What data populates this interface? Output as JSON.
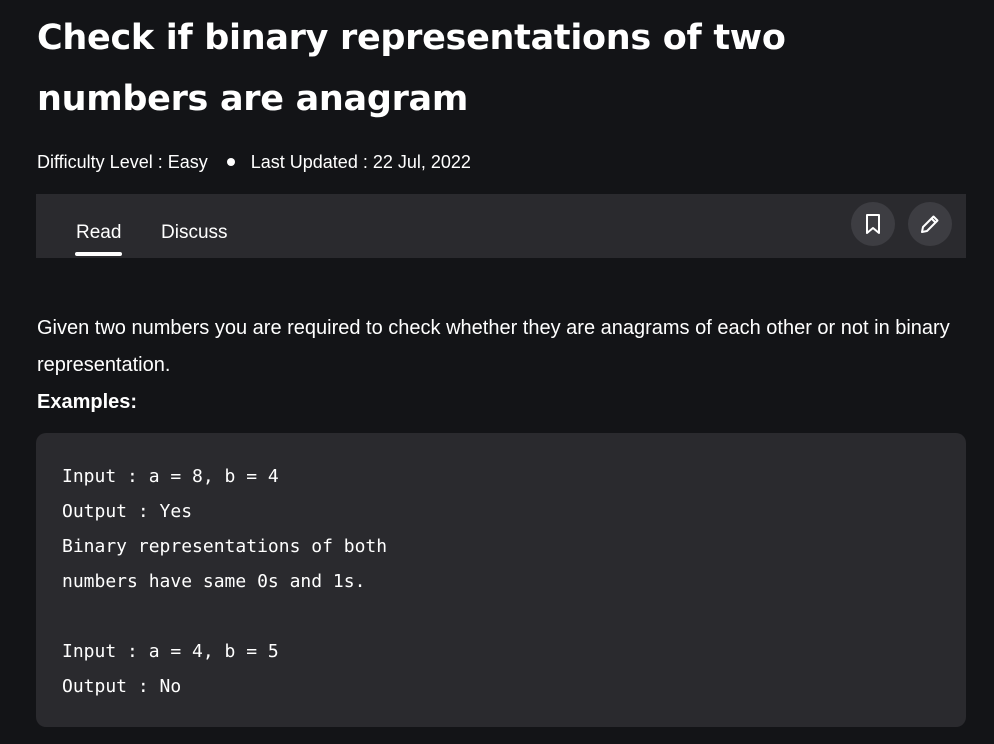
{
  "article": {
    "title": "Check if binary representations of two numbers are anagram",
    "difficulty": "Difficulty Level : Easy",
    "last_updated": "Last Updated : 22 Jul, 2022"
  },
  "tabs": [
    {
      "label": "Read",
      "active": true
    },
    {
      "label": "Discuss",
      "active": false
    }
  ],
  "actions": {
    "bookmark_icon": "bookmark-icon",
    "edit_icon": "pencil-icon"
  },
  "body": {
    "intro": "Given two numbers you are required to check whether they are anagrams of each other or not in binary representation.",
    "examples_heading": "Examples:",
    "code_lines": [
      "Input : a = 8, b = 4",
      "Output : Yes",
      "Binary representations of both",
      "numbers have same 0s and 1s.",
      "",
      "Input : a = 4, b = 5",
      "Output : No"
    ]
  },
  "colors": {
    "background": "#131417",
    "panel": "#2a2a2e",
    "text": "#ffffff"
  }
}
